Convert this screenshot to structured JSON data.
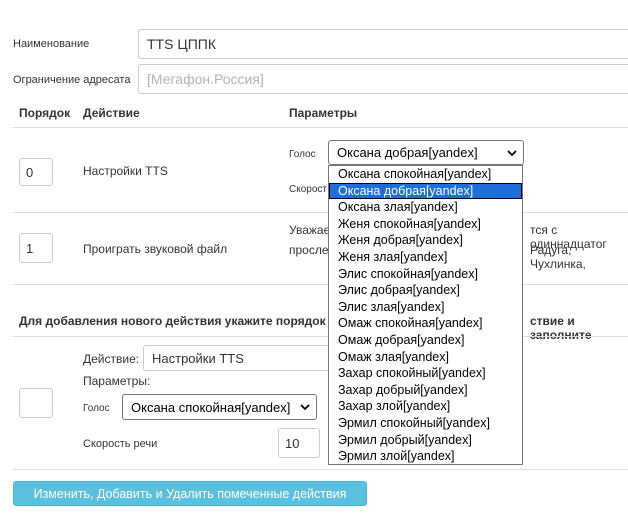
{
  "form": {
    "name_label": "Наименование",
    "name_value": "TTS ЦППК",
    "restriction_label": "Ограничение адресата",
    "restriction_placeholder": "[Мегафон.Россия]"
  },
  "table": {
    "headers": {
      "order": "Порядок",
      "action": "Действие",
      "params": "Параметры"
    },
    "rows": [
      {
        "order": "0",
        "action": "Настройки TTS",
        "voice_label": "Голос",
        "voice_selected": "Оксана добрая[yandex]",
        "speed_label_partial": "Скорост"
      },
      {
        "order": "1",
        "action": "Проиграть звуковой файл",
        "text_line1_left": "Уважае",
        "text_line1_right": "тся с одиннадцатог",
        "text_line2_left": "просле",
        "text_line2_right": "Радуга, Чухлинка,"
      }
    ]
  },
  "add_section": {
    "instruction_left": "Для добавления нового действия укажите порядок",
    "instruction_right": "ствие и заполните",
    "action_label": "Действие:",
    "action_value": "Настройки TTS",
    "params_label": "Параметры:",
    "voice_label": "Голос",
    "voice_value": "Оксана спокойная[yandex]",
    "speed_label": "Скорость речи",
    "speed_value": "10"
  },
  "dropdown": {
    "options": [
      "Оксана спокойная[yandex]",
      "Оксана добрая[yandex]",
      "Оксана злая[yandex]",
      "Женя спокойная[yandex]",
      "Женя добрая[yandex]",
      "Женя злая[yandex]",
      "Элис спокойная[yandex]",
      "Элис добрая[yandex]",
      "Элис злая[yandex]",
      "Омаж спокойная[yandex]",
      "Омаж добрая[yandex]",
      "Омаж злая[yandex]",
      "Захар спокойный[yandex]",
      "Захар добрый[yandex]",
      "Захар злой[yandex]",
      "Эрмил спокойный[yandex]",
      "Эрмил добрый[yandex]",
      "Эрмил злой[yandex]"
    ],
    "selected_index": 1
  },
  "buttons": {
    "submit_label": "Изменить, Добавить и Удалить помеченные действия"
  },
  "colors": {
    "button_bg": "#5bc0de",
    "selection_bg": "#1e6fd9",
    "border": "#cccccc"
  }
}
